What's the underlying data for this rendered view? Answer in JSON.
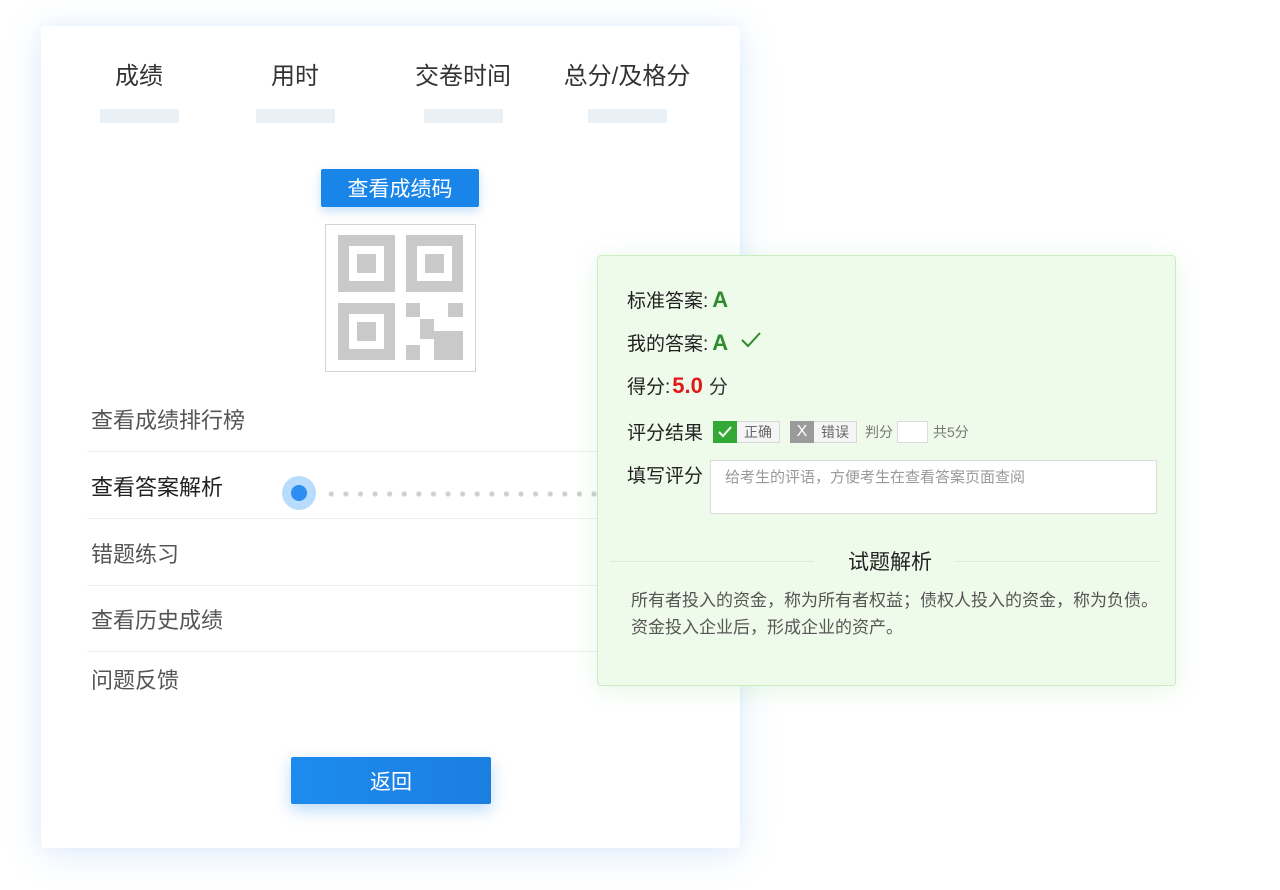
{
  "stats": [
    {
      "label": "成绩"
    },
    {
      "label": "用时"
    },
    {
      "label": "交卷时间"
    },
    {
      "label": "总分/及格分"
    }
  ],
  "view_code_button": "查看成绩码",
  "qr_icon": "qr-code-icon",
  "menu": [
    {
      "label": "查看成绩排行榜"
    },
    {
      "label": "查看答案解析"
    },
    {
      "label": "错题练习"
    },
    {
      "label": "查看历史成绩"
    },
    {
      "label": "问题反馈"
    }
  ],
  "back_button": "返回",
  "answer_panel": {
    "standard_label": "标准答案:",
    "standard_value": "A",
    "my_label": "我的答案:",
    "my_value": "A",
    "score_label": "得分:",
    "score_value": "5.0",
    "score_unit": "分",
    "result_label": "评分结果",
    "correct_label": "正确",
    "wrong_mark": "X",
    "wrong_label": "错误",
    "judge_label": "判分",
    "total_label": "共5分",
    "comment_label": "填写评分",
    "comment_placeholder": "给考生的评语，方便考生在查看答案页面查阅",
    "analysis_title": "试题解析",
    "analysis_text": "所有者投入的资金，称为所有者权益；债权人投入的资金，称为负债。资金投入企业后，形成企业的资产。"
  },
  "colors": {
    "primary": "#1a85e8",
    "correct_green": "#34a834",
    "score_red": "#e01818",
    "panel_bg": "#effbea"
  }
}
